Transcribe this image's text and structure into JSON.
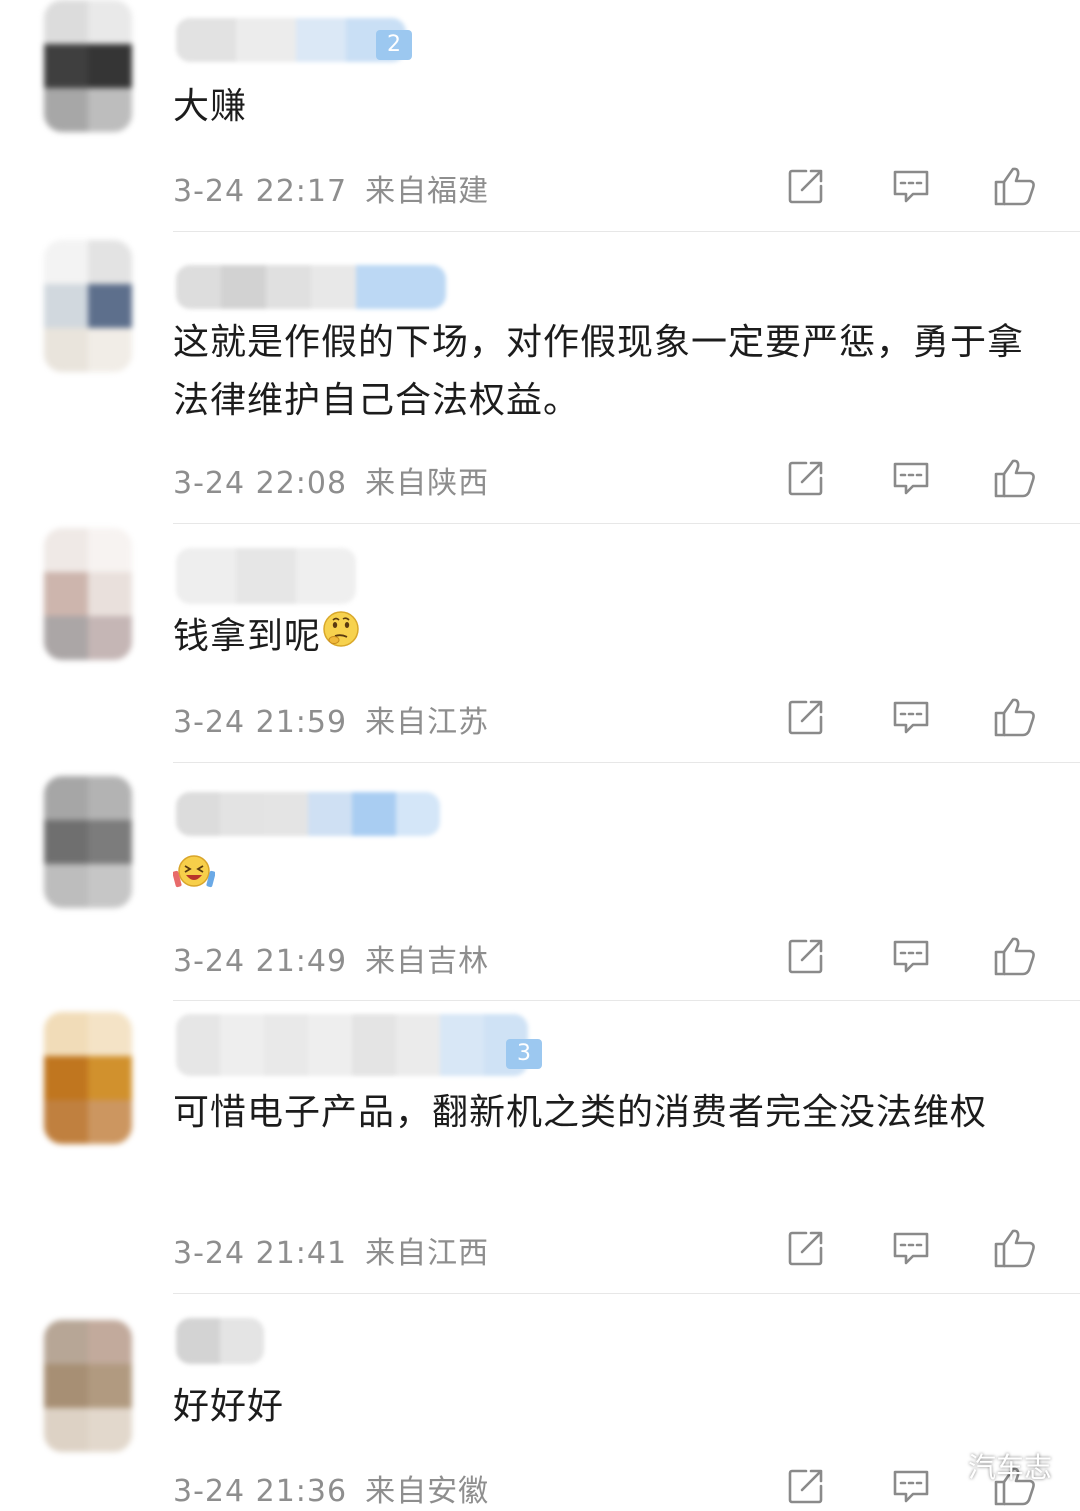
{
  "comments": [
    {
      "badge": "2",
      "text": "大赚",
      "time": "3-24 22:17",
      "location": "来自福建"
    },
    {
      "badge": "",
      "text": "这就是作假的下场，对作假现象一定要严惩，勇于拿法律维护自己合法权益。",
      "time": "3-24 22:08",
      "location": "来自陕西"
    },
    {
      "badge": "",
      "text": "钱拿到呢",
      "time": "3-24 21:59",
      "location": "来自江苏"
    },
    {
      "badge": "",
      "text": "",
      "time": "3-24 21:49",
      "location": "来自吉林"
    },
    {
      "badge": "3",
      "text": "可惜电子产品，翻新机之类的消费者完全没法维权",
      "time": "3-24 21:41",
      "location": "来自江西"
    },
    {
      "badge": "",
      "text": "好好好",
      "time": "3-24 21:36",
      "location": "来自安徽"
    }
  ],
  "icons": {
    "share": "share-icon",
    "reply": "comment-icon",
    "like": "thumbs-up-icon",
    "emoji_comment3": "thinking-face-emoji-icon",
    "emoji_comment4": "laughing-cheering-emoji-icon",
    "watermark": "wechat-icon"
  },
  "watermark": {
    "text": "汽车志"
  },
  "colors": {
    "text": "#1c1c1c",
    "meta": "#8e8e8e",
    "icon": "#8a8a8a",
    "divider": "#e7e7e7",
    "badge": "#9cc8f0"
  }
}
